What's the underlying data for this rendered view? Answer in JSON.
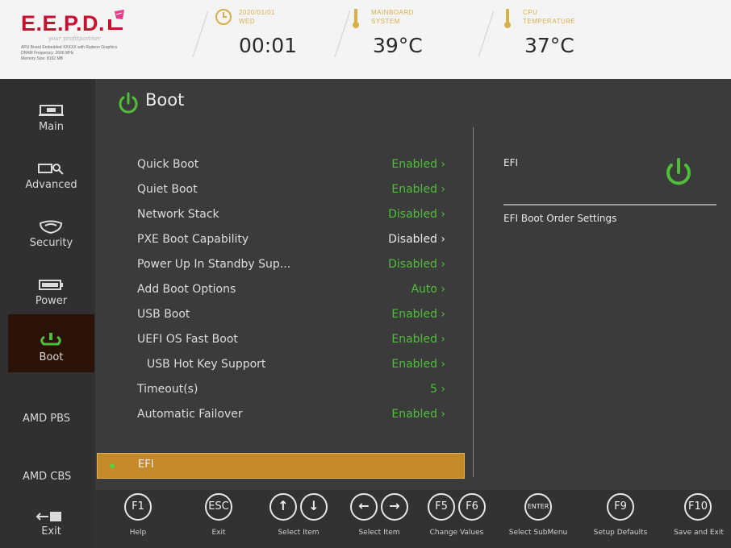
{
  "header": {
    "logo_text": "E.E.P.D.",
    "logo_tagline": "your profitpartner",
    "logo_info": [
      "APU Board Embedded XXXXX with Radeon Graphics",
      "DRAM Frequency: 2666 MHz",
      "Memory Size: 8192 MB"
    ],
    "date_label": "2020/01/01",
    "day_label": "WED",
    "time": "00:01",
    "mainboard_label_1": "MAINBOARD",
    "mainboard_label_2": "SYSTEM",
    "mainboard_temp": "39°C",
    "cpu_label_1": "CPU",
    "cpu_label_2": "TEMPERATURE",
    "cpu_temp": "37°C"
  },
  "sidebar": {
    "items": [
      {
        "label": "Main",
        "icon": "computer-icon"
      },
      {
        "label": "Advanced",
        "icon": "advanced-icon"
      },
      {
        "label": "Security",
        "icon": "shield-icon"
      },
      {
        "label": "Power",
        "icon": "battery-icon"
      },
      {
        "label": "Boot",
        "icon": "power-icon",
        "active": true
      },
      {
        "label": "AMD PBS"
      },
      {
        "label": "AMD CBS"
      },
      {
        "label": "Exit",
        "icon": "exit-icon"
      }
    ]
  },
  "page": {
    "title": "Boot",
    "settings": [
      {
        "label": "Quick Boot",
        "value": "Enabled ›"
      },
      {
        "label": "Quiet Boot",
        "value": "Enabled ›"
      },
      {
        "label": "Network Stack",
        "value": "Disabled ›"
      },
      {
        "label": "PXE Boot Capability",
        "value": "Disabled ›"
      },
      {
        "label": "Power Up In Standby Sup...",
        "value": "Disabled ›"
      },
      {
        "label": "Add Boot Options",
        "value": "Auto ›"
      },
      {
        "label": "USB Boot",
        "value": "Enabled ›"
      },
      {
        "label": "UEFI OS Fast Boot",
        "value": "Enabled ›"
      },
      {
        "label": "USB Hot Key Support",
        "value": "Enabled ›"
      },
      {
        "label": "Timeout(s)",
        "value": "5 ›"
      },
      {
        "label": "Automatic Failover",
        "value": "Enabled ›"
      }
    ],
    "selected_item": "EFI"
  },
  "help": {
    "title": "EFI",
    "description": "EFI Boot Order Settings"
  },
  "keys": [
    {
      "key": "F1",
      "label": "Help"
    },
    {
      "key": "ESC",
      "label": "Exit"
    },
    {
      "key": "↑↓",
      "label": "Select Item"
    },
    {
      "key": "←→",
      "label": "Select Item"
    },
    {
      "key": "F5F6",
      "label": "Change Values"
    },
    {
      "key": "ENTER",
      "label": "Select SubMenu"
    },
    {
      "key": "F9",
      "label": "Setup Defaults"
    },
    {
      "key": "F10",
      "label": "Save and Exit"
    }
  ],
  "colors": {
    "accent_green": "#4fbf3a",
    "selection_gold": "#c48a2a",
    "logo_red": "#c8102e"
  }
}
